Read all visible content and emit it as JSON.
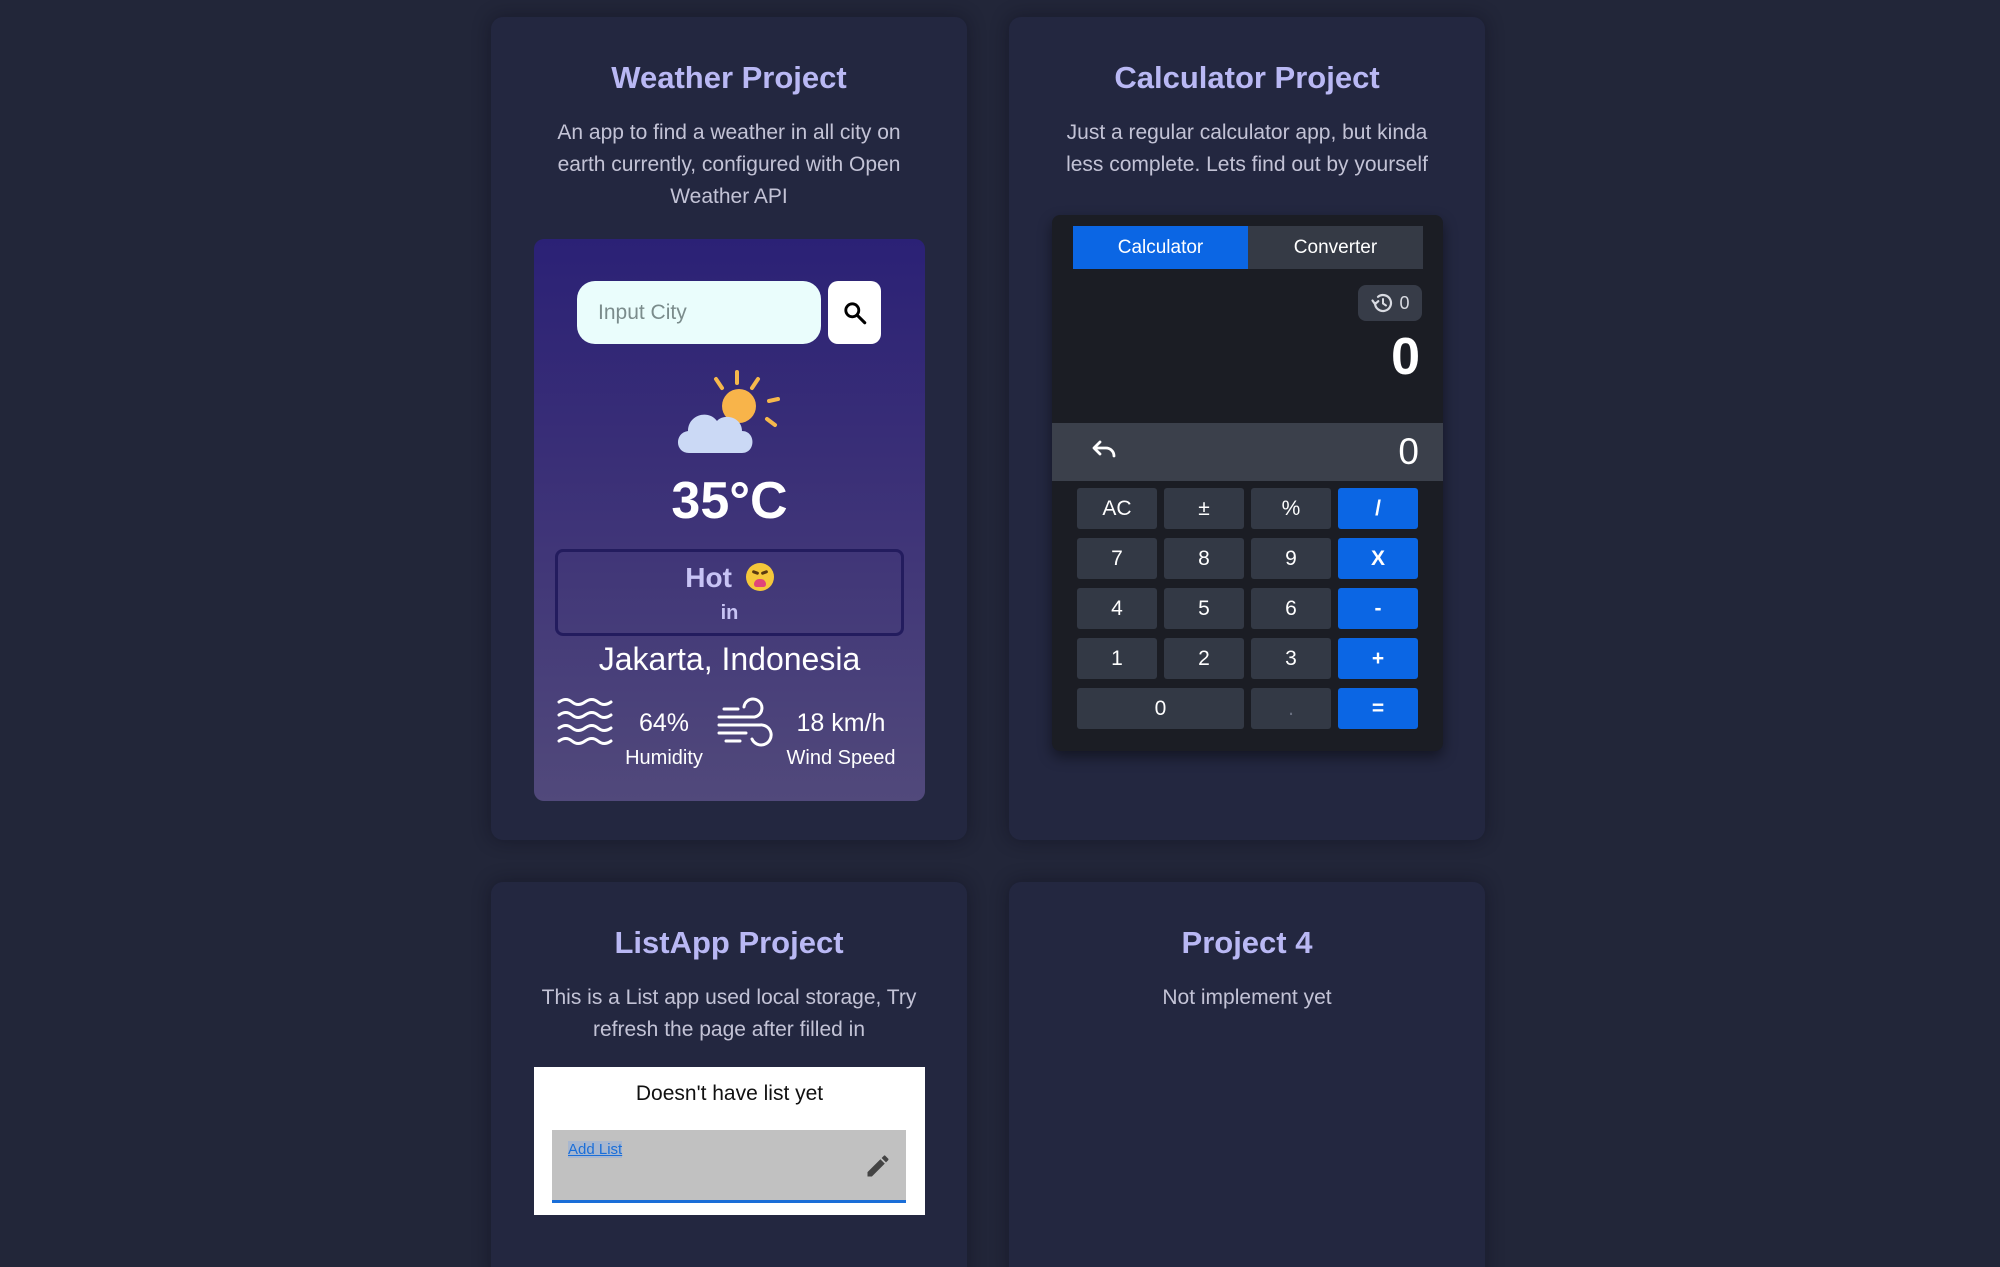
{
  "weather_card": {
    "title": "Weather Project",
    "description": "An app to find a weather in all city on earth currently, configured with Open Weather API",
    "search_placeholder": "Input City",
    "search_icon": "search-icon",
    "weather_icon": "partly-cloudy-sun-icon",
    "temperature": "35°C",
    "feel": "Hot",
    "feel_emoji": "tired-face-emoji",
    "feel_sub": "in",
    "location": "Jakarta, Indonesia",
    "humidity_value": "64%",
    "humidity_label": "Humidity",
    "wind_value": "18 km/h",
    "wind_label": "Wind Speed"
  },
  "calculator_card": {
    "title": "Calculator Project",
    "description": "Just a regular calculator app, but kinda less complete. Lets find out by yourself",
    "tabs": [
      "Calculator",
      "Converter"
    ],
    "history_count": "0",
    "display": "0",
    "sub_display": "0",
    "keys": {
      "ac": "AC",
      "plusminus": "±",
      "percent": "%",
      "divide": "/",
      "k7": "7",
      "k8": "8",
      "k9": "9",
      "multiply": "X",
      "k4": "4",
      "k5": "5",
      "k6": "6",
      "minus": "-",
      "k1": "1",
      "k2": "2",
      "k3": "3",
      "plus": "+",
      "k0": "0",
      "dot": ".",
      "equals": "="
    },
    "colors": {
      "accent": "#0b66e4",
      "key_bg": "#333945",
      "panel_bg": "#1b1d24"
    }
  },
  "list_card": {
    "title": "ListApp Project",
    "description": "This is a List app used local storage, Try refresh the page after filled in",
    "empty_text": "Doesn't have list yet",
    "add_label": "Add List"
  },
  "project4_card": {
    "title": "Project 4",
    "description": "Not implement yet"
  },
  "colors": {
    "page_bg": "#222639",
    "card_bg": "#232740",
    "title": "#b9b8f4"
  }
}
